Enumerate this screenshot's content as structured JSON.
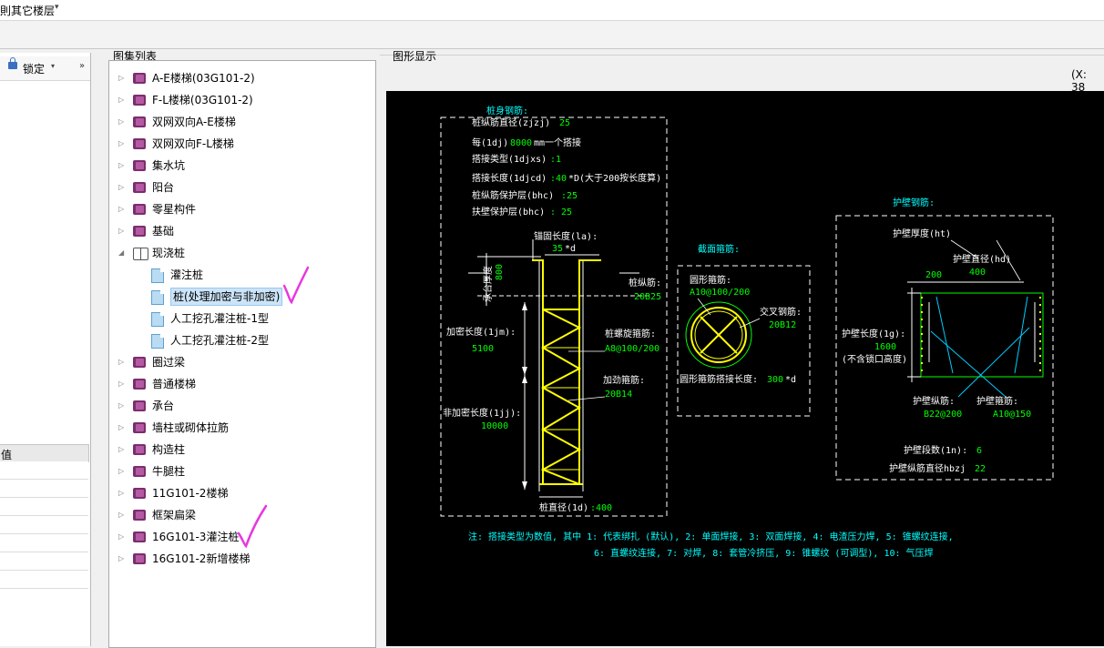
{
  "topbar": {
    "label": "則其它楼层",
    "arrow": "▾"
  },
  "lockbar": {
    "label": "锁定",
    "arrow": "▾",
    "more": "»"
  },
  "props": {
    "header": "值"
  },
  "tree": {
    "title": "图集列表",
    "items": [
      {
        "label": "A-E楼梯(03G101-2)",
        "icon": "book-icon",
        "level": 0,
        "state": "collapsed"
      },
      {
        "label": "F-L楼梯(03G101-2)",
        "icon": "book-icon",
        "level": 0,
        "state": "collapsed"
      },
      {
        "label": "双网双向A-E楼梯",
        "icon": "book-icon",
        "level": 0,
        "state": "collapsed"
      },
      {
        "label": "双网双向F-L楼梯",
        "icon": "book-icon",
        "level": 0,
        "state": "collapsed"
      },
      {
        "label": "集水坑",
        "icon": "book-icon",
        "level": 0,
        "state": "collapsed"
      },
      {
        "label": "阳台",
        "icon": "book-icon",
        "level": 0,
        "state": "collapsed"
      },
      {
        "label": "零星构件",
        "icon": "book-icon",
        "level": 0,
        "state": "collapsed"
      },
      {
        "label": "基础",
        "icon": "book-icon",
        "level": 0,
        "state": "collapsed"
      },
      {
        "label": "现浇桩",
        "icon": "open-book-icon",
        "level": 0,
        "state": "expanded"
      },
      {
        "label": "灌注桩",
        "icon": "doc-icon",
        "level": 1,
        "state": "leaf"
      },
      {
        "label": "桩(处理加密与非加密)",
        "icon": "doc-icon",
        "level": 1,
        "state": "selected"
      },
      {
        "label": "人工挖孔灌注桩-1型",
        "icon": "doc-icon",
        "level": 1,
        "state": "leaf"
      },
      {
        "label": "人工挖孔灌注桩-2型",
        "icon": "doc-icon",
        "level": 1,
        "state": "leaf"
      },
      {
        "label": "圈过梁",
        "icon": "book-icon",
        "level": 0,
        "state": "collapsed"
      },
      {
        "label": "普通楼梯",
        "icon": "book-icon",
        "level": 0,
        "state": "collapsed"
      },
      {
        "label": "承台",
        "icon": "book-icon",
        "level": 0,
        "state": "collapsed"
      },
      {
        "label": "墙柱或砌体拉筋",
        "icon": "book-icon",
        "level": 0,
        "state": "collapsed"
      },
      {
        "label": "构造柱",
        "icon": "book-icon",
        "level": 0,
        "state": "collapsed"
      },
      {
        "label": "牛腿柱",
        "icon": "book-icon",
        "level": 0,
        "state": "collapsed"
      },
      {
        "label": "11G101-2楼梯",
        "icon": "book-icon",
        "level": 0,
        "state": "collapsed"
      },
      {
        "label": "框架扁梁",
        "icon": "book-icon",
        "level": 0,
        "state": "collapsed"
      },
      {
        "label": "16G101-3灌注桩",
        "icon": "book-icon",
        "level": 0,
        "state": "collapsed"
      },
      {
        "label": "16G101-2新增楼梯",
        "icon": "book-icon",
        "level": 0,
        "state": "collapsed"
      }
    ],
    "annotation_color": "#e837e0"
  },
  "graph": {
    "title": "图形显示",
    "coord": "(X: 38",
    "bg": "#000000",
    "colors": {
      "white": "#ffffff",
      "cyan": "#00ffff",
      "green": "#00ff00",
      "yellow": "#ffff00",
      "red": "#ff3b3b"
    },
    "pile": {
      "heading": "桩身钢筋:",
      "p1_label": "桩纵筋直径(zjzj)",
      "p1_value": "25",
      "p2_label": "每(1dj)",
      "p2_value": "8000",
      "p2_unit": "mm一个搭接",
      "p3_label": "搭接类型(1djxs)",
      "p3_value": ":1",
      "p4_label": "搭接长度(1djcd)",
      "p4_value": ":40",
      "p4_unit": "*D(大于200按长度算)",
      "p5_label": "桩纵筋保护层(bhc)",
      "p5_value": ":25",
      "p6_label": "扶壁保护层(bhc)",
      "p6_value": ": 25",
      "anchor_label": "锚固长度(la):",
      "anchor_value": "35",
      "anchor_unit": "*d",
      "cap_label": "承台厚度",
      "cap_value": "800",
      "long_label": "桩纵筋:",
      "long_value": "20B25",
      "dense_label": "加密长度(1jm):",
      "dense_value": "5100",
      "spiral_label": "桩螺旋箍筋:",
      "spiral_value": "A8@100/200",
      "stiff_label": "加劲箍筋:",
      "stiff_value": "20B14",
      "nondense_label": "非加密长度(1jj):",
      "nondense_value": "10000",
      "dia_label": "桩直径(1d)",
      "dia_value": ":400"
    },
    "section": {
      "heading": "截面箍筋:",
      "circle_label": "圆形箍筋:",
      "circle_value": "A10@100/200",
      "cross_label": "交叉钢筋:",
      "cross_value": "20B12",
      "lap_label": "圆形箍筋搭接长度:",
      "lap_value": "300",
      "lap_unit": "*d"
    },
    "wall": {
      "heading": "护壁钢筋:",
      "thick_label": "护壁厚度(ht)",
      "thick_value": "200",
      "dia_label": "护壁直径(hd)",
      "dia_value": "400",
      "len_label": "护壁长度(1g):",
      "len_value": "1600",
      "len_note": "(不含锁口高度)",
      "long_label": "护壁纵筋:",
      "long_value": "B22@200",
      "stir_label": "护壁箍筋:",
      "stir_value": "A10@150",
      "seg_label": "护壁段数(1n):",
      "seg_value": "6",
      "bar_label": "护壁纵筋直径hbzj",
      "bar_value": "22"
    },
    "note1": "注: 搭接类型为数值, 其中 1: 代表绑扎 (默认), 2: 单面焊接, 3: 双面焊接, 4: 电渣压力焊, 5: 锥螺纹连接,",
    "note2": "6: 直螺纹连接, 7: 对焊, 8: 套管冷挤压, 9: 锥螺纹 (可调型), 10: 气压焊"
  }
}
